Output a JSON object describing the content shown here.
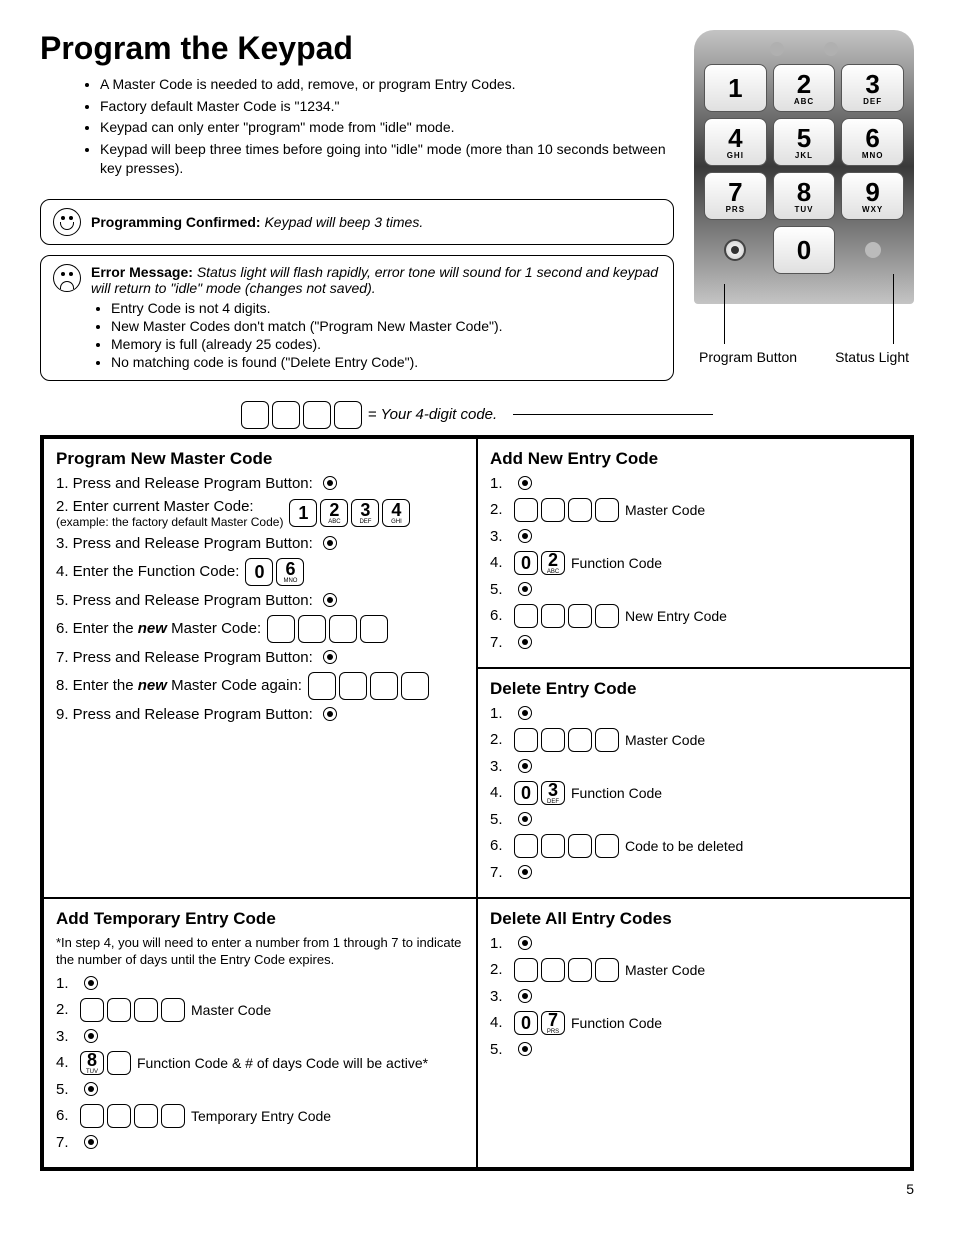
{
  "title": "Program the Keypad",
  "intro": [
    "A Master Code is needed to add, remove, or program Entry Codes.",
    "Factory default Master Code is \"1234.\"",
    "Keypad can only enter \"program\" mode from \"idle\" mode.",
    "Keypad will beep three times before going into \"idle\" mode (more than 10 seconds between key presses)."
  ],
  "confirm": {
    "label": "Programming Confirmed:",
    "text": "Keypad will beep 3 times."
  },
  "error": {
    "label": "Error Message:",
    "text": "Status light will flash rapidly, error tone will sound for 1 second and keypad will return to \"idle\" mode (changes not saved).",
    "reasons": [
      "Entry Code is not 4 digits.",
      "New Master Codes don't match (\"Program New Master Code\").",
      "Memory is full (already 25 codes).",
      "No matching code is found (\"Delete Entry Code\")."
    ]
  },
  "keypad_labels": {
    "program": "Program Button",
    "status": "Status Light"
  },
  "keys": [
    {
      "n": "1",
      "s": ""
    },
    {
      "n": "2",
      "s": "ABC"
    },
    {
      "n": "3",
      "s": "DEF"
    },
    {
      "n": "4",
      "s": "GHI"
    },
    {
      "n": "5",
      "s": "JKL"
    },
    {
      "n": "6",
      "s": "MNO"
    },
    {
      "n": "7",
      "s": "PRS"
    },
    {
      "n": "8",
      "s": "TUV"
    },
    {
      "n": "9",
      "s": "WXY"
    },
    {
      "n": "0",
      "s": ""
    }
  ],
  "legend": "= Your 4-digit code.",
  "sections": {
    "new_master": {
      "title": "Program New Master Code",
      "s1": "1. Press and Release Program Button:",
      "s2": "2. Enter current Master Code:",
      "s2ex": "(example: the factory default Master Code)",
      "s3": "3. Press and Release Program Button:",
      "s4": "4. Enter the Function Code:",
      "s5": "5. Press and Release Program Button:",
      "s6": "6. Enter the new Master Code:",
      "s7": "7. Press and Release Program Button:",
      "s8": "8. Enter the new Master Code again:",
      "s9": "9. Press and Release Program Button:"
    },
    "temp": {
      "title": "Add Temporary Entry Code",
      "note": "*In step 4, you will need to enter a number from 1 through 7 to indicate the number of days until the Entry Code expires.",
      "l_master": "Master Code",
      "l_func": "Function Code & # of days Code will be active*",
      "l_temp": "Temporary Entry Code"
    },
    "add": {
      "title": "Add New Entry Code",
      "l_master": "Master Code",
      "l_func": "Function Code",
      "l_new": "New Entry Code"
    },
    "del": {
      "title": "Delete Entry Code",
      "l_master": "Master Code",
      "l_func": "Function Code",
      "l_code": "Code to be deleted"
    },
    "del_all": {
      "title": "Delete All Entry Codes",
      "l_master": "Master Code",
      "l_func": "Function Code"
    }
  },
  "page_num": "5"
}
